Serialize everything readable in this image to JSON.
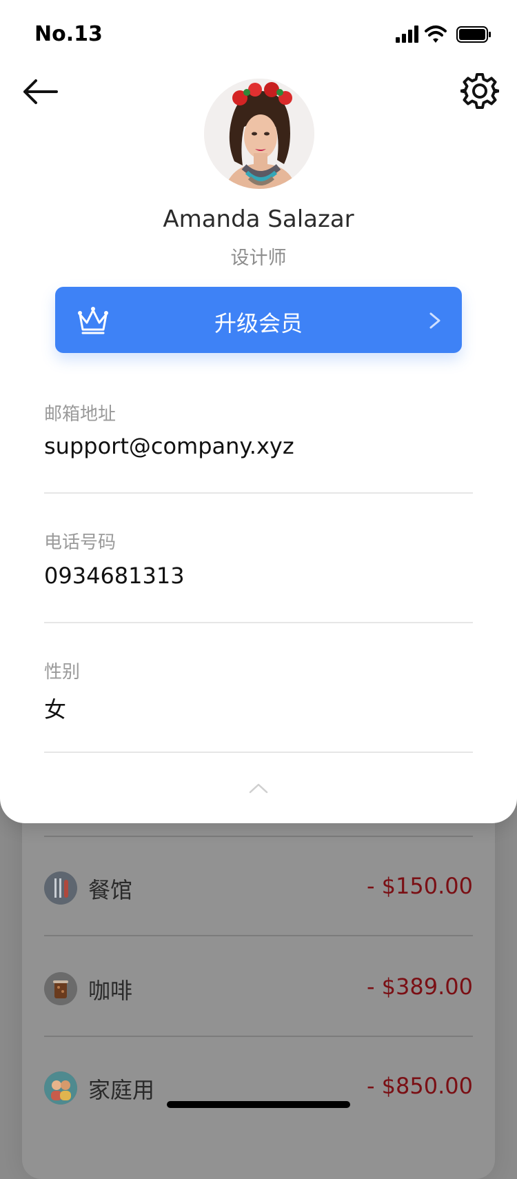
{
  "status_bar": {
    "time": "No.13"
  },
  "profile": {
    "name": "Amanda Salazar",
    "role": "设计师",
    "upgrade_label": "升级会员"
  },
  "fields": [
    {
      "label": "邮箱地址",
      "value": "support@company.xyz"
    },
    {
      "label": "电话号码",
      "value": "0934681313"
    },
    {
      "label": "性别",
      "value": "女"
    }
  ],
  "transactions": [
    {
      "label": "餐馆",
      "amount": "- $150.00",
      "icon": "utensils-icon"
    },
    {
      "label": "咖啡",
      "amount": "- $389.00",
      "icon": "coffee-icon"
    },
    {
      "label": "家庭用",
      "amount": "- $850.00",
      "icon": "family-icon"
    }
  ],
  "colors": {
    "accent": "#3e82f6",
    "negative_amount": "#7a0f14",
    "label_gray": "#9a9a9a"
  }
}
